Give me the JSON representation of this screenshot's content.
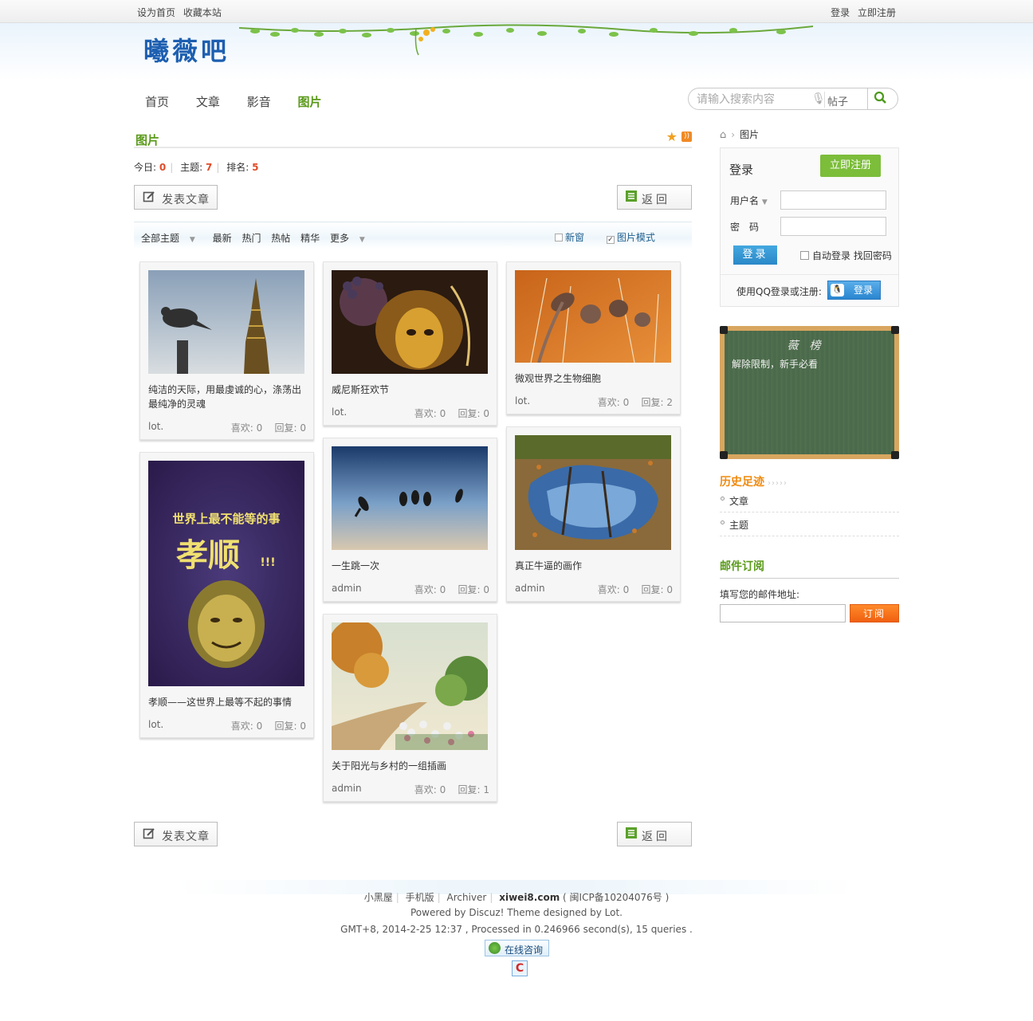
{
  "topbar": {
    "set_home": "设为首页",
    "favorite": "收藏本站",
    "login": "登录",
    "register": "立即注册"
  },
  "logo": {
    "text": "曦薇吧"
  },
  "nav": {
    "items": [
      "首页",
      "文章",
      "影音",
      "图片"
    ],
    "active_index": 3
  },
  "search": {
    "placeholder": "请输入搜索内容",
    "type": "帖子"
  },
  "page": {
    "title": "图片"
  },
  "stats": {
    "today_label": "今日:",
    "today": "0",
    "topics_label": "主题:",
    "topics": "7",
    "rank_label": "排名:",
    "rank": "5"
  },
  "actions": {
    "post": "发表文章",
    "back": "返回"
  },
  "filter": {
    "all": "全部主题",
    "latest": "最新",
    "hot": "热门",
    "hot_posts": "热帖",
    "digest": "精华",
    "more": "更多",
    "new_window": "新窗",
    "image_mode": "图片模式",
    "image_mode_checked": true
  },
  "cards": [
    {
      "title": "纯洁的天际，用最虔诚的心，涤荡出最纯净的灵魂",
      "author": "lot.",
      "likes_label": "喜欢:",
      "likes": "0",
      "replies_label": "回复:",
      "replies": "0"
    },
    {
      "title": "威尼斯狂欢节",
      "author": "lot.",
      "likes_label": "喜欢:",
      "likes": "0",
      "replies_label": "回复:",
      "replies": "0"
    },
    {
      "title": "微观世界之生物细胞",
      "author": "lot.",
      "likes_label": "喜欢:",
      "likes": "0",
      "replies_label": "回复:",
      "replies": "2"
    },
    {
      "title": "孝顺——这世界上最等不起的事情",
      "author": "lot.",
      "likes_label": "喜欢:",
      "likes": "0",
      "replies_label": "回复:",
      "replies": "0",
      "poster_line1": "世界上最不能等的事",
      "poster_line2": "孝顺",
      "poster_line3": "!!!"
    },
    {
      "title": "一生跳一次",
      "author": "admin",
      "likes_label": "喜欢:",
      "likes": "0",
      "replies_label": "回复:",
      "replies": "0"
    },
    {
      "title": "真正牛逼的画作",
      "author": "admin",
      "likes_label": "喜欢:",
      "likes": "0",
      "replies_label": "回复:",
      "replies": "0"
    },
    {
      "title": "关于阳光与乡村的一组插画",
      "author": "admin",
      "likes_label": "喜欢:",
      "likes": "0",
      "replies_label": "回复:",
      "replies": "1"
    }
  ],
  "sidebar": {
    "breadcrumb": "图片",
    "login": {
      "title": "登录",
      "register": "立即注册",
      "username_label": "用户名",
      "password_label": "密　码",
      "submit": "登录",
      "auto_login": "自动登录",
      "find_password": "找回密码",
      "qq_text": "使用QQ登录或注册:",
      "qq_button": "登录"
    },
    "board": {
      "title": "薇榜",
      "item": "解除限制，新手必看"
    },
    "history": {
      "title": "历史足迹",
      "dots": "›››››",
      "items": [
        "文章",
        "主题"
      ]
    },
    "mail": {
      "title": "邮件订阅",
      "label": "填写您的邮件地址:",
      "button": "订阅"
    }
  },
  "footer": {
    "links": [
      "小黑屋",
      "手机版",
      "Archiver"
    ],
    "site": "xiwei8.com",
    "icp": "( 闽ICP备10204076号 )",
    "powered": "Powered by Discuz! Theme designed by Lot.",
    "stats": "GMT+8, 2014-2-25 12:37 , Processed in 0.246966 second(s), 15 queries .",
    "consult": "在线咨询"
  },
  "colors": {
    "accent_green": "#5a9a1a",
    "number_red": "#e04c2a",
    "orange": "#f08a10"
  }
}
